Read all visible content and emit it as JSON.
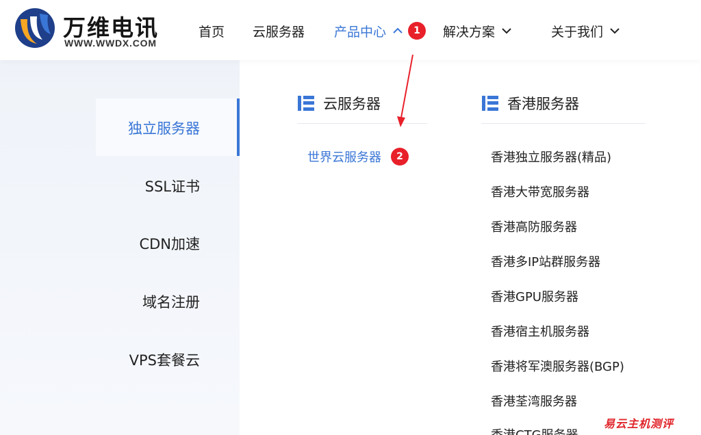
{
  "brand": {
    "name": "万维电讯",
    "url": "WWW.WWDX.COM",
    "colors": {
      "blue": "#3a76d6",
      "orange": "#f5a623",
      "dark_blue": "#1f3f8a"
    }
  },
  "nav": {
    "items": [
      {
        "label": "首页",
        "has_chevron": false
      },
      {
        "label": "云服务器",
        "has_chevron": false
      },
      {
        "label": "产品中心",
        "has_chevron": true,
        "chevron": "chevron-up-icon",
        "active": true,
        "badge": "1"
      },
      {
        "label": "解决方案",
        "has_chevron": true,
        "chevron": "chevron-down-icon"
      },
      {
        "label": "关于我们",
        "has_chevron": true,
        "chevron": "chevron-down-icon"
      }
    ]
  },
  "categories": [
    {
      "label": "独立服务器",
      "active": true
    },
    {
      "label": "SSL证书"
    },
    {
      "label": "CDN加速"
    },
    {
      "label": "域名注册"
    },
    {
      "label": "VPS套餐云"
    }
  ],
  "groups": [
    {
      "title": "云服务器",
      "icon": "server-list-icon",
      "items": [
        {
          "label": "世界云服务器",
          "badge": "2"
        }
      ]
    },
    {
      "title": "香港服务器",
      "icon": "server-list-icon",
      "items": [
        {
          "label": "香港独立服务器(精品)"
        },
        {
          "label": "香港大带宽服务器"
        },
        {
          "label": "香港高防服务器"
        },
        {
          "label": "香港多IP站群服务器"
        },
        {
          "label": "香港GPU服务器"
        },
        {
          "label": "香港宿主机服务器"
        },
        {
          "label": "香港将军澳服务器(BGP)"
        },
        {
          "label": "香港荃湾服务器"
        },
        {
          "label": "香港CTG服务器"
        }
      ]
    }
  ],
  "annotation_color": "#e8202a",
  "watermark": "易云主机测评"
}
